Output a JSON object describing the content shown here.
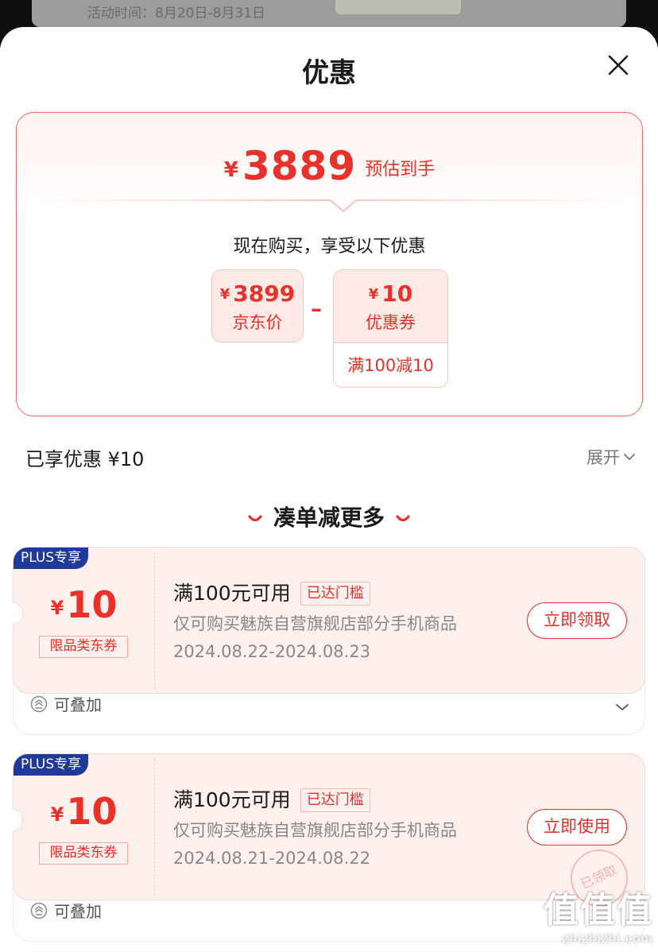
{
  "backdrop": {
    "text": "活动时间：8月20日-8月31日"
  },
  "sheet": {
    "title": "优惠"
  },
  "summary": {
    "currency": "¥",
    "estimated_price": "3889",
    "estimated_label": "预估到手",
    "intro": "现在购买，享受以下优惠",
    "jd_price_value": "3899",
    "jd_price_label": "京东价",
    "minus_sign": "–",
    "coupon_value": "10",
    "coupon_label": "优惠券",
    "coupon_condition": "满100减10"
  },
  "enjoyed": {
    "label": "已享优惠 ¥10",
    "expand_label": "展开"
  },
  "section": {
    "title": "凑单减更多"
  },
  "coupons": [
    {
      "badge": "PLUS专享",
      "currency": "¥",
      "amount": "10",
      "type": "限品类东券",
      "condition": "满100元可用",
      "reached": "已达门槛",
      "scope": "仅可购买魅族自营旗舰店部分手机商品",
      "dates": "2024.08.22-2024.08.23",
      "action": "立即领取",
      "stackable": "可叠加"
    },
    {
      "badge": "PLUS专享",
      "currency": "¥",
      "amount": "10",
      "type": "限品类东券",
      "condition": "满100元可用",
      "reached": "已达门槛",
      "scope": "仅可购买魅族自营旗舰店部分手机商品",
      "dates": "2024.08.21-2024.08.22",
      "action": "立即使用",
      "stackable": "可叠加"
    }
  ],
  "stamp": {
    "text": "已领取"
  },
  "watermark": {
    "main": "值值值",
    "site": "zhizhizhi.com"
  },
  "colors": {
    "accent": "#e8312a",
    "plus_badge": "#1f3a9a",
    "card_bg": "#fdf0ed"
  },
  "icons": {
    "close": "close-icon",
    "expand": "chevron-down-icon",
    "stack": "stack-icon"
  }
}
